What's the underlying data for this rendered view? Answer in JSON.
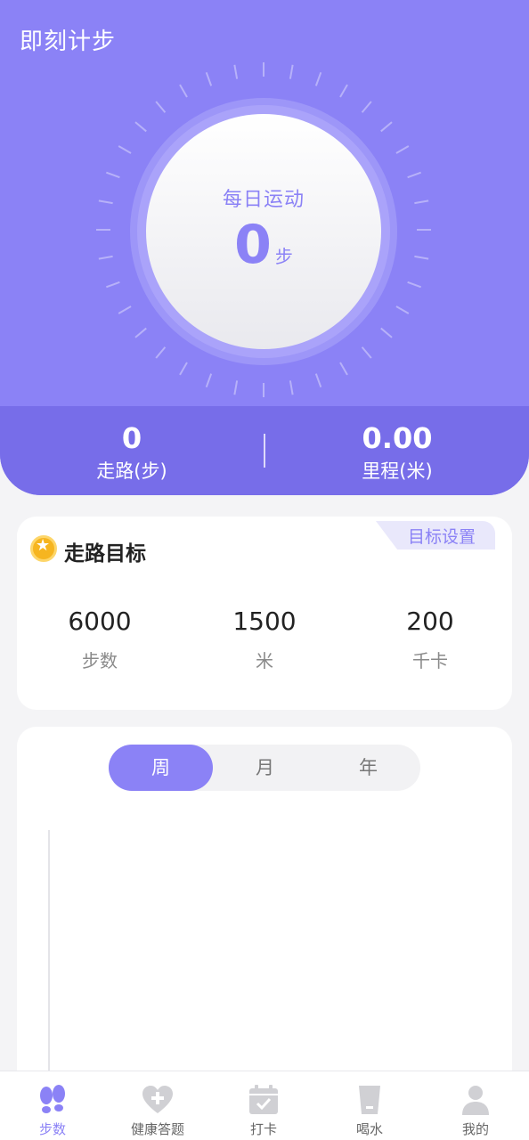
{
  "app": {
    "title": "即刻计步"
  },
  "daily": {
    "label": "每日运动",
    "value": "0",
    "unit": "步"
  },
  "stats": {
    "walk": {
      "value": "0",
      "label": "走路(步)"
    },
    "distance": {
      "value": "0.00",
      "label": "里程(米)"
    }
  },
  "goal": {
    "title": "走路目标",
    "settings_label": "目标设置",
    "items": [
      {
        "value": "6000",
        "label": "步数"
      },
      {
        "value": "1500",
        "label": "米"
      },
      {
        "value": "200",
        "label": "千卡"
      }
    ]
  },
  "period_tabs": [
    {
      "label": "周",
      "active": true
    },
    {
      "label": "月",
      "active": false
    },
    {
      "label": "年",
      "active": false
    }
  ],
  "tabbar": [
    {
      "label": "步数",
      "icon": "footprints-icon",
      "active": true
    },
    {
      "label": "健康答题",
      "icon": "heart-plus-icon",
      "active": false
    },
    {
      "label": "打卡",
      "icon": "calendar-check-icon",
      "active": false
    },
    {
      "label": "喝水",
      "icon": "water-cup-icon",
      "active": false
    },
    {
      "label": "我的",
      "icon": "user-icon",
      "active": false
    }
  ],
  "colors": {
    "primary": "#8b82f6",
    "primary_dark": "#776de9",
    "background": "#f4f4f6",
    "inactive_icon": "#d0d0d4"
  }
}
